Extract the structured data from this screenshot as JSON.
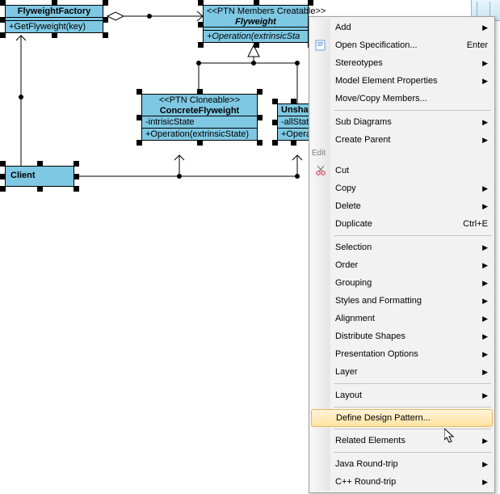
{
  "classes": {
    "flyweightFactory": {
      "name": "FlyweightFactory",
      "op": "+GetFlyweight(key)"
    },
    "flyweight": {
      "stereo": "<<PTN Members Creatable>>",
      "name": "Flyweight",
      "op": "+Operation(extrinsicSta"
    },
    "concreteFlyweight": {
      "stereo": "<<PTN Cloneable>>",
      "name": "ConcreteFlyweight",
      "attr": "-intrisicState",
      "op": "+Operation(extrinsicState)"
    },
    "unshared": {
      "name": "Unsha",
      "attr": "-allState",
      "op": "+Opera"
    },
    "client": {
      "name": "Client"
    }
  },
  "menu": {
    "group_edit": "Edit",
    "add": "Add",
    "openSpec": "Open Specification...",
    "openSpec_accel": "Enter",
    "stereotypes": "Stereotypes",
    "modelElemProps": "Model Element Properties",
    "moveCopy": "Move/Copy Members...",
    "subDiagrams": "Sub Diagrams",
    "createParent": "Create Parent",
    "cut": "Cut",
    "copy": "Copy",
    "delete": "Delete",
    "duplicate": "Duplicate",
    "duplicate_accel": "Ctrl+E",
    "selection": "Selection",
    "order": "Order",
    "grouping": "Grouping",
    "stylesFmt": "Styles and Formatting",
    "alignment": "Alignment",
    "distribute": "Distribute Shapes",
    "presentation": "Presentation Options",
    "layer": "Layer",
    "layout": "Layout",
    "defineDP": "Define Design Pattern...",
    "related": "Related Elements",
    "javaRT": "Java Round-trip",
    "cppRT": "C++ Round-trip"
  }
}
